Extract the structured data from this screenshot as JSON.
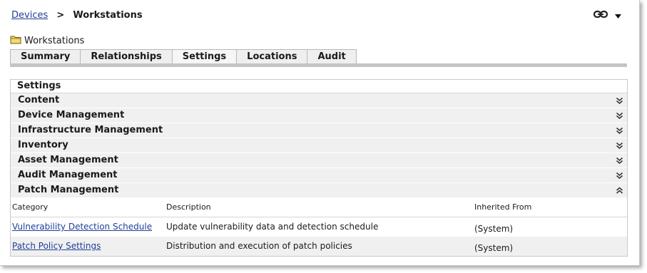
{
  "breadcrumb": {
    "parent": "Devices",
    "separator": ">",
    "current": "Workstations"
  },
  "folder": {
    "name": "Workstations",
    "icon": "folder-icon"
  },
  "toolbar": {
    "link_icon": "chain-link-icon",
    "menu_icon": "caret-down-icon"
  },
  "tabs": [
    {
      "label": "Summary"
    },
    {
      "label": "Relationships"
    },
    {
      "label": "Settings",
      "active": true
    },
    {
      "label": "Locations"
    },
    {
      "label": "Audit"
    }
  ],
  "settings": {
    "title": "Settings",
    "sections": [
      {
        "label": "Content",
        "state": "collapsed"
      },
      {
        "label": "Device Management",
        "state": "collapsed"
      },
      {
        "label": "Infrastructure Management",
        "state": "collapsed"
      },
      {
        "label": "Inventory",
        "state": "collapsed"
      },
      {
        "label": "Asset Management",
        "state": "collapsed"
      },
      {
        "label": "Audit Management",
        "state": "collapsed"
      },
      {
        "label": "Patch Management",
        "state": "expanded"
      }
    ]
  },
  "patch_table": {
    "headers": {
      "category": "Category",
      "description": "Description",
      "inherited": "Inherited From"
    },
    "rows": [
      {
        "category": "Vulnerability Detection Schedule",
        "description": "Update vulnerability data and detection schedule",
        "inherited": "(System)"
      },
      {
        "category": "Patch Policy Settings",
        "description": "Distribution and execution of patch policies",
        "inherited": "(System)"
      }
    ]
  },
  "colors": {
    "link": "#1f3f99",
    "tab_bg": "#efefef",
    "section_bg": "#f0f0f0",
    "tab_underline": "#c4c4c4"
  }
}
